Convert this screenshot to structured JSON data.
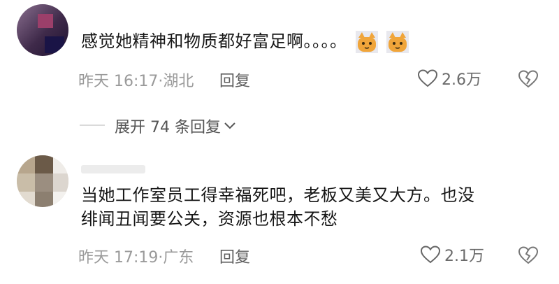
{
  "comments": [
    {
      "text": "感觉她精神和物质都好富足啊。。。。",
      "emoji": [
        "cat-face-emoji",
        "cat-face-emoji"
      ],
      "time_location": "昨天 16:17·湖北",
      "reply_label": "回复",
      "likes": "2.6万"
    },
    {
      "text_line1": "当她工作室员工得幸福死吧，老板又美又大方。也没",
      "text_line2": "绯闻丑闻要公关，资源也根本不愁",
      "time_location": "昨天 17:19·广东",
      "reply_label": "回复",
      "likes": "2.1万"
    }
  ],
  "expand_replies": "展开 74 条回复",
  "icons": {
    "like": "heart-outline-icon",
    "dislike": "broken-heart-icon",
    "expand": "chevron-down-icon"
  },
  "colors": {
    "text": "#161616",
    "meta": "#9a9a9a",
    "cat_orange": "#f0a53a"
  }
}
